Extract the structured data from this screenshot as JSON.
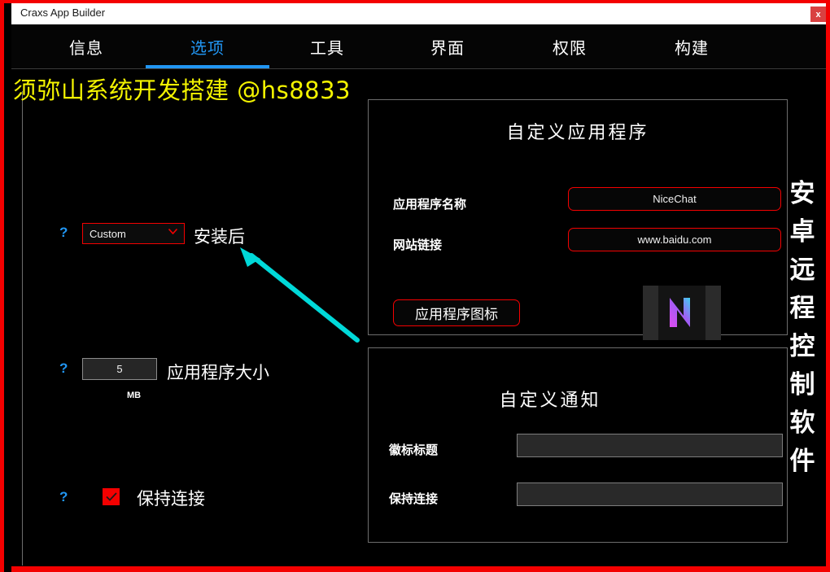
{
  "window": {
    "title": "Craxs App Builder",
    "close_label": "x"
  },
  "tabs": [
    {
      "label": "信息",
      "active": false
    },
    {
      "label": "选项",
      "active": true
    },
    {
      "label": "工具",
      "active": false
    },
    {
      "label": "界面",
      "active": false
    },
    {
      "label": "权限",
      "active": false
    },
    {
      "label": "构建",
      "active": false
    }
  ],
  "watermark": {
    "text": "须弥山系统开发搭建  @hs8833",
    "color": "#f3f300"
  },
  "left_panel": {
    "help_icon_label": "?",
    "install_after": {
      "label": "安装后",
      "selected": "Custom"
    },
    "app_size": {
      "label": "应用程序大小",
      "value": "5",
      "unit": "MB"
    },
    "keep_alive": {
      "label": "保持连接",
      "checked": true
    }
  },
  "app_panel": {
    "title": "自定义应用程序",
    "name_label": "应用程序名称",
    "name_value": "NiceChat",
    "url_label": "网站链接",
    "url_value": "www.baidu.com",
    "icon_button_label": "应用程序图标",
    "icon_glyph": "N"
  },
  "notify_panel": {
    "title": "自定义通知",
    "title_label": "徽标标题",
    "title_value": "",
    "body_label": "保持连接",
    "body_value": ""
  },
  "side_text": {
    "chars": [
      "安",
      "卓",
      "远",
      "程",
      "控",
      "制",
      "软",
      "件"
    ]
  },
  "colors": {
    "frame_red": "#f40000",
    "accent_blue": "#2196f3",
    "annotation_cyan": "#00d9d9",
    "watermark_yellow": "#f3f300",
    "background": "#000000"
  }
}
